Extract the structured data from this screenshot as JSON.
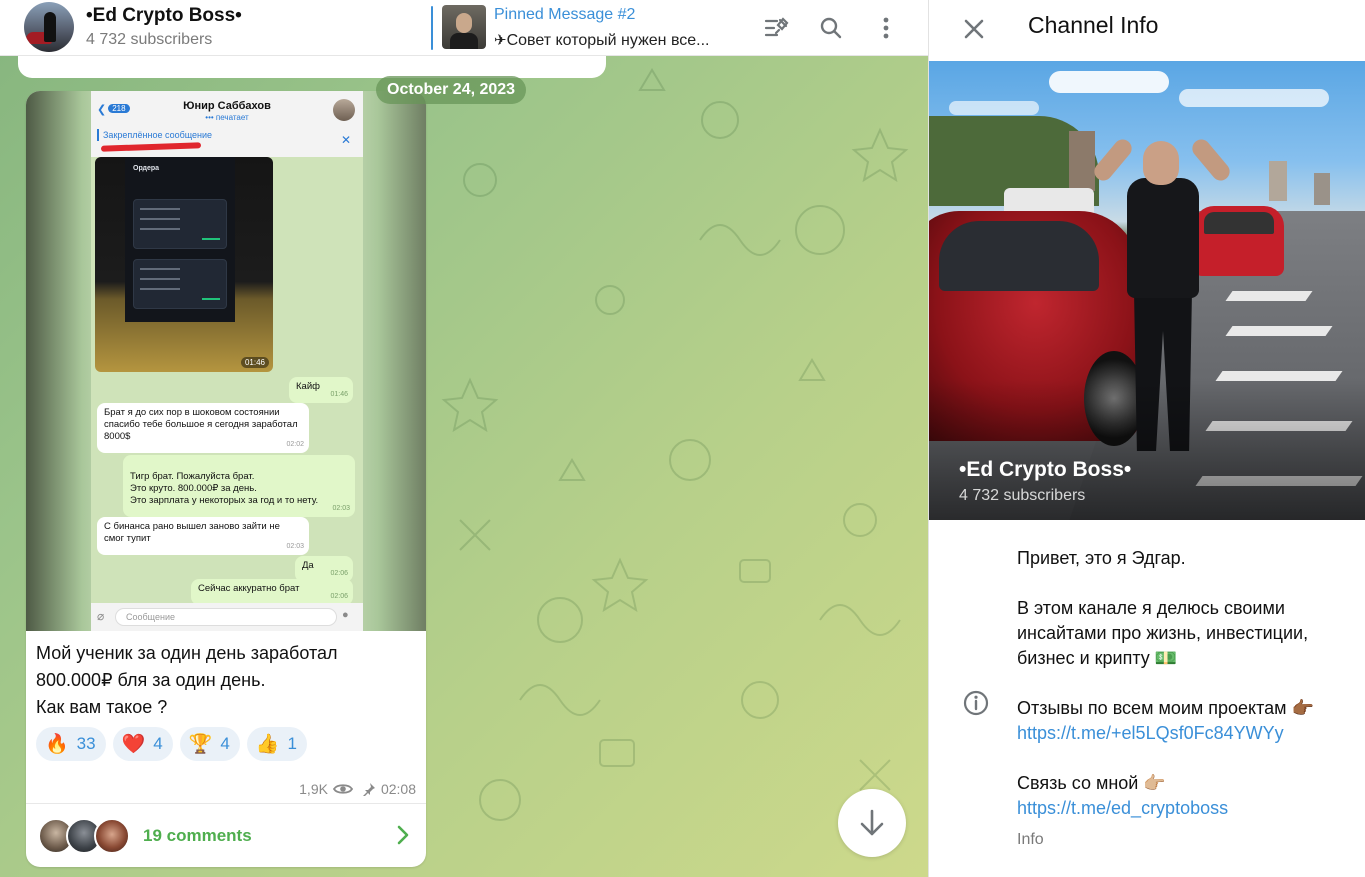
{
  "header": {
    "channel_name": "•Ed Crypto Boss•",
    "subscribers": "4 732 subscribers",
    "pinned_title": "Pinned Message #2",
    "pinned_emoji": "✈",
    "pinned_text": "Совет который нужен все..."
  },
  "chat": {
    "date": "October 24, 2023",
    "post": {
      "screenshot": {
        "back_count": "218",
        "contact_name": "Юнир Саббахов",
        "contact_status": "••• печатает",
        "pinned_label": "Закреплённое сообщение",
        "photo_time": "01:46",
        "screen_title": "Ордера",
        "messages": [
          {
            "text": "Кайф",
            "time": "01:46",
            "dir": "out"
          },
          {
            "text": "Брат я до сих пор в шоковом состоянии спасибо тебе большое я сегодня заработал 8000$",
            "time": "02:02",
            "dir": "in"
          },
          {
            "text": "Тигр брат. Пожалуйста брат.\nЭто круто. 800.000₽ за день.\nЭто зарплата у некоторых за год и то нету.",
            "time": "02:03",
            "dir": "out"
          },
          {
            "text": "С бинанса рано вышел заново зайти не смог тупит",
            "time": "02:03",
            "dir": "in"
          },
          {
            "text": "Да",
            "time": "02:06",
            "dir": "out"
          },
          {
            "text": "Сейчас аккуратно брат",
            "time": "02:06",
            "dir": "out"
          }
        ],
        "input_placeholder": "Сообщение"
      },
      "text_lines": [
        "Мой ученик за один день заработал",
        "800.000₽ бля за один день.",
        "Как вам такое ?"
      ],
      "reactions": [
        {
          "emoji": "🔥",
          "count": "33"
        },
        {
          "emoji": "❤️",
          "count": "4"
        },
        {
          "emoji": "🏆",
          "count": "4"
        },
        {
          "emoji": "👍",
          "count": "1"
        }
      ],
      "views": "1,9K",
      "time": "02:08",
      "comments": "19 comments"
    }
  },
  "info_panel": {
    "title": "Channel Info",
    "channel_name": "•Ed Crypto Boss•",
    "subscribers": "4 732 subscribers",
    "about": {
      "greeting": "Привет, это я Эдгар.",
      "intro": "В этом канале я делюсь своими инсайтами про жизнь, инвестиции, бизнес и крипту 💵",
      "reviews_label": "Отзывы по всем моим проектам 👉🏾",
      "reviews_link": "https://t.me/+el5LQsf0Fc84YWYy",
      "contact_label": "Связь со мной 👉🏼",
      "contact_link": "https://t.me/ed_cryptoboss"
    },
    "section_label": "Info"
  },
  "colors": {
    "accent": "#3a8fd8",
    "comments_green": "#4fae4e"
  }
}
